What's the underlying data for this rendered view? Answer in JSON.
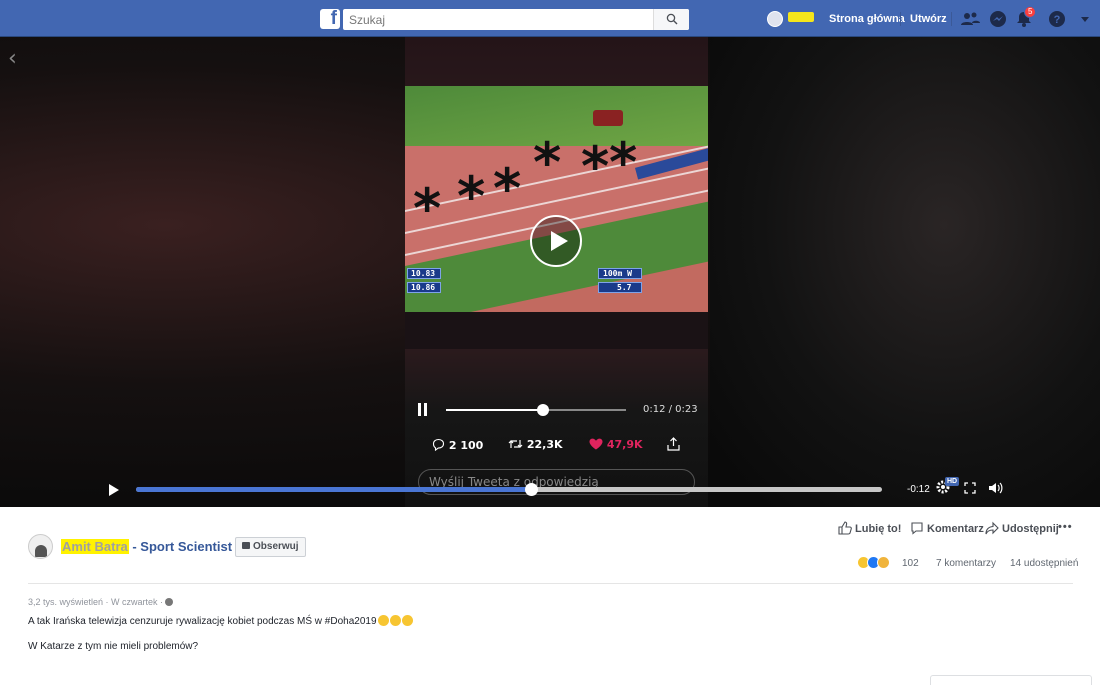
{
  "topbar": {
    "search_placeholder": "Szukaj",
    "home_label": "Strona główna",
    "create_label": "Utwórz",
    "notifications_count": "5",
    "brand_color": "#4267b2"
  },
  "video": {
    "tweet_elapsed": "0:12 / 0:23",
    "tweet_progress": 0.54,
    "replies": "2 100",
    "retweets": "22,3K",
    "likes": "47,9K",
    "reply_placeholder": "Wyślij Tweeta z odpowiedzią",
    "score_left_1": "10.83",
    "score_left_2": "10.86",
    "score_right_1": "100m W",
    "score_right_2": "5.7",
    "fb_progress": 0.53,
    "fb_remaining": "-0:12",
    "hd_label": "HD"
  },
  "post": {
    "page_name_redacted": "Amit Batra",
    "page_name_suffix": " - Sport Scientist",
    "follow_label": "Obserwuj",
    "like_label": "Lubię to!",
    "comment_label": "Komentarz",
    "share_label": "Udostępnij",
    "reactions_count": "102",
    "comments_count": "7 komentarzy",
    "shares_count": "14 udostępnień",
    "meta": "3,2 tys. wyświetleń · W czwartek ·",
    "text_line_1": "A tak Irańska telewizja cenzuruje rywalizację kobiet podczas MŚ w #Doha2019",
    "text_line_2": "W Katarze z tym nie mieli problemów?"
  }
}
